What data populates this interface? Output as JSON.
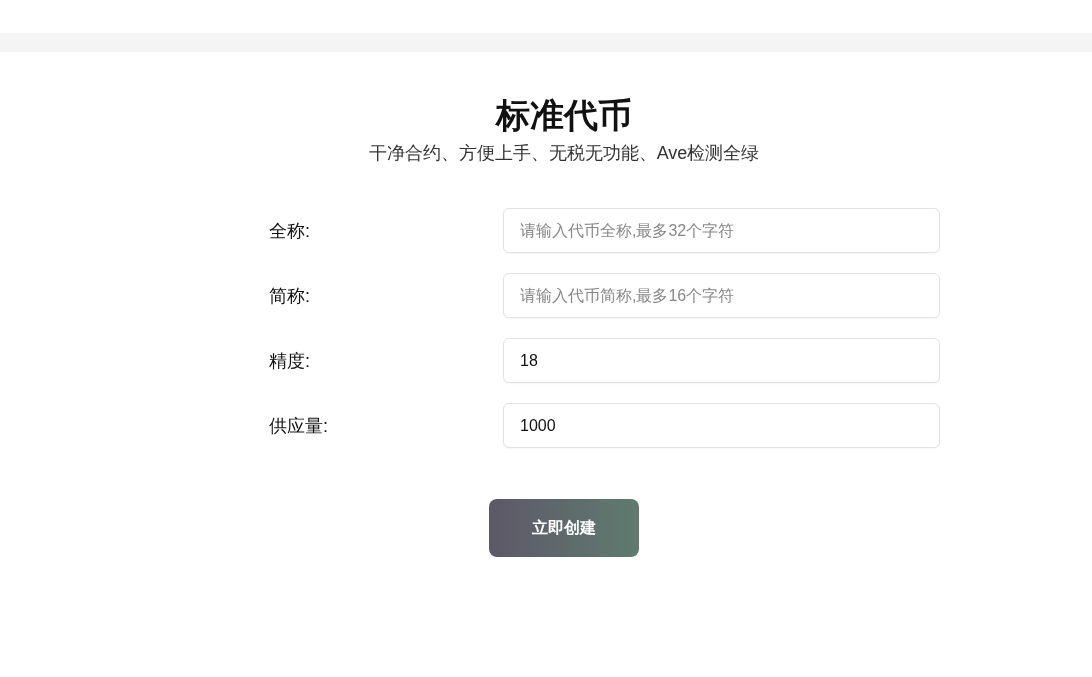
{
  "header": {
    "title": "标准代币",
    "subtitle": "干净合约、方便上手、无税无功能、Ave检测全绿"
  },
  "form": {
    "fields": [
      {
        "label": "全称:",
        "placeholder": "请输入代币全称,最多32个字符"
      },
      {
        "label": "简称:",
        "placeholder": "请输入代币简称,最多16个字符"
      },
      {
        "label": "精度:",
        "value": "18"
      },
      {
        "label": "供应量:",
        "value": "1000"
      }
    ],
    "submit_button": "立即创建"
  }
}
